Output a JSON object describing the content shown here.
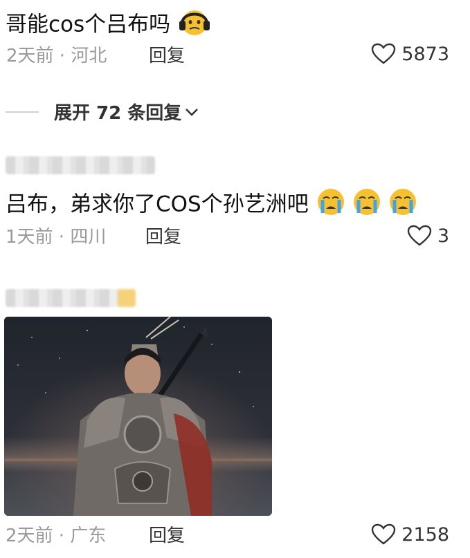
{
  "comments": [
    {
      "text": "哥能cos个吕布吗",
      "emoji": "headphones-face-emoji",
      "time": "2天前 · 河北",
      "reply_label": "回复",
      "likes": "5873"
    },
    {
      "text": "吕布，弟求你了COS个孙艺洲吧",
      "emoji": "crying-face-emoji",
      "time": "1天前 · 四川",
      "reply_label": "回复",
      "likes": "3"
    },
    {
      "image": "lu-bu-armored-warrior-photo",
      "time": "2天前 · 广东",
      "reply_label": "回复",
      "likes": "2158"
    }
  ],
  "expand_replies_label": "展开 72 条回复",
  "colors": {
    "text": "#111111",
    "meta": "#9a9a9a",
    "divider": "#cfcfcf",
    "emoji_yellow": "#f6c02e",
    "tear_blue": "#3ea4ee"
  },
  "icons": [
    "heart-outline-icon",
    "chevron-down-icon"
  ]
}
